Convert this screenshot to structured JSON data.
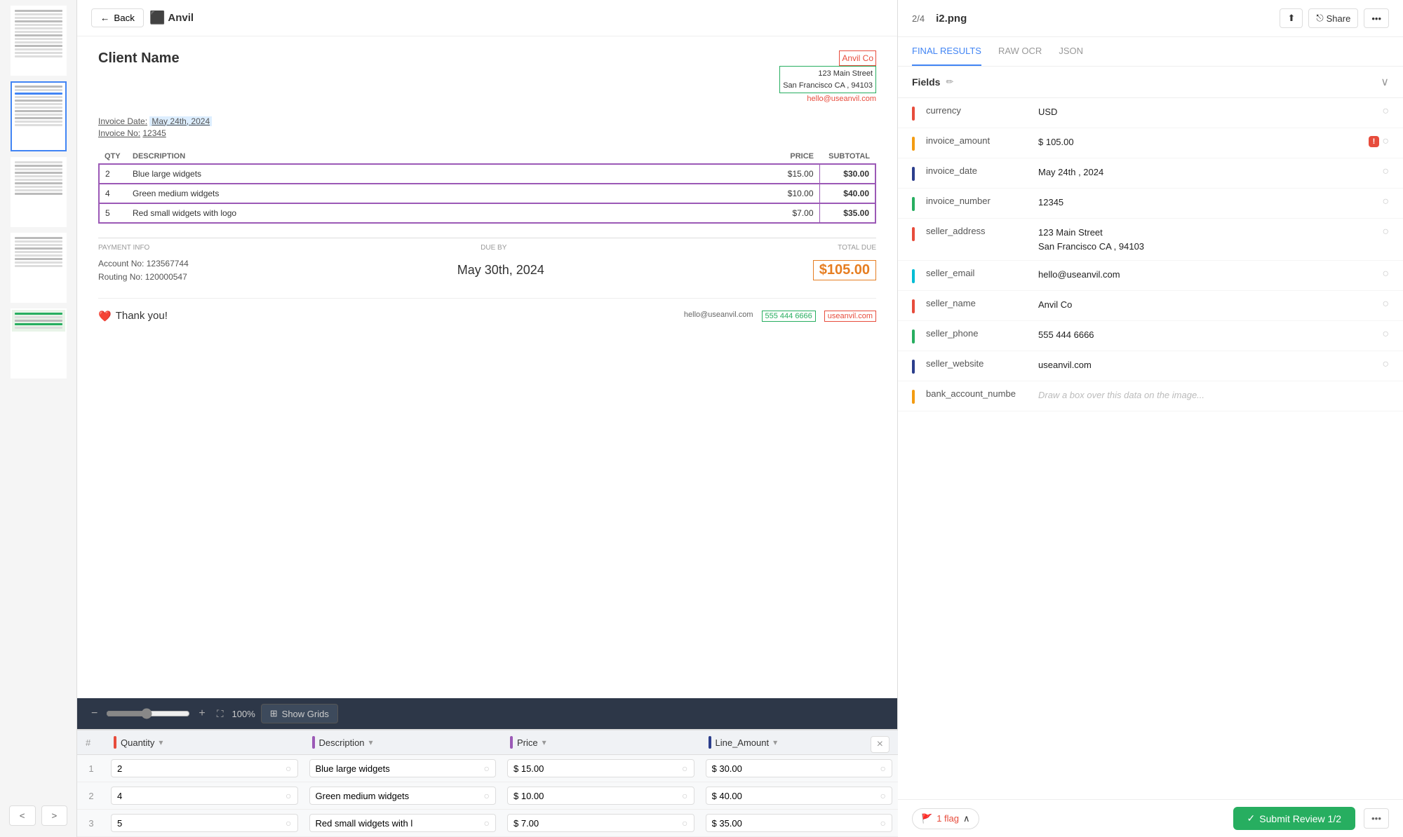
{
  "app": {
    "back_label": "Back"
  },
  "sidebar": {
    "thumbnails": [
      {
        "id": 1,
        "label": "Page 1 thumbnail"
      },
      {
        "id": 2,
        "label": "Page 2 thumbnail",
        "active": true
      },
      {
        "id": 3,
        "label": "Page 3 thumbnail"
      },
      {
        "id": 4,
        "label": "Page 4 thumbnail"
      },
      {
        "id": 5,
        "label": "Page 5 thumbnail"
      }
    ],
    "prev_label": "<",
    "next_label": ">"
  },
  "header": {
    "logo": "⬛ Anvil",
    "page_indicator": "2/4",
    "file_name": "i2.png",
    "upload_icon": "⬆",
    "share_label": "Share",
    "more_icon": "..."
  },
  "tabs": {
    "items": [
      {
        "id": "final",
        "label": "FINAL RESULTS",
        "active": true
      },
      {
        "id": "raw",
        "label": "RAW OCR",
        "active": false
      },
      {
        "id": "json",
        "label": "JSON",
        "active": false
      }
    ]
  },
  "invoice": {
    "client_name": "Client Name",
    "seller_name": "Anvil Co",
    "seller_address_line1": "123 Main Street",
    "seller_address_line2": "San Francisco CA , 94103",
    "seller_email": "hello@useanvil.com",
    "invoice_date_label": "Invoice Date:",
    "invoice_date_value": "May 24th, 2024",
    "invoice_no_label": "Invoice No:",
    "invoice_no_value": "12345",
    "table": {
      "headers": [
        "QTY",
        "DESCRIPTION",
        "PRICE",
        "SUBTOTAL"
      ],
      "rows": [
        {
          "qty": "2",
          "desc": "Blue large widgets",
          "price": "$15.00",
          "subtotal": "$30.00"
        },
        {
          "qty": "4",
          "desc": "Green medium widgets",
          "price": "$10.00",
          "subtotal": "$40.00"
        },
        {
          "qty": "5",
          "desc": "Red small widgets with logo",
          "price": "$7.00",
          "subtotal": "$35.00"
        }
      ]
    },
    "payment_info_label": "PAYMENT INFO",
    "due_by_label": "DUE BY",
    "total_due_label": "TOTAL DUE",
    "account_no_label": "Account No:",
    "account_no_value": "123567744",
    "routing_no_label": "Routing No:",
    "routing_no_value": "120000547",
    "due_date": "May 30th, 2024",
    "total_amount": "$105.00",
    "thank_you": "Thank you!",
    "contact_email": "hello@useanvil.com",
    "contact_phone": "555 444 6666",
    "contact_website": "useanvil.com"
  },
  "toolbar": {
    "zoom_minus": "−",
    "zoom_plus": "+",
    "zoom_level": "100%",
    "zoom_expand": "⛶",
    "show_grids_icon": "⊞",
    "show_grids_label": "Show Grids"
  },
  "fields": {
    "title": "Fields",
    "items": [
      {
        "id": "currency",
        "label": "currency",
        "value": "USD",
        "color": "#e74c3c",
        "has_warning": false
      },
      {
        "id": "invoice_amount",
        "label": "invoice_amount",
        "value": "$ 105.00",
        "color": "#f39c12",
        "has_warning": true,
        "warning_count": "!"
      },
      {
        "id": "invoice_date",
        "label": "invoice_date",
        "value": "May 24th , 2024",
        "color": "#2c3e8c",
        "has_warning": false
      },
      {
        "id": "invoice_number",
        "label": "invoice_number",
        "value": "12345",
        "color": "#27ae60",
        "has_warning": false
      },
      {
        "id": "seller_address",
        "label": "seller_address",
        "value": "123 Main Street\nSan Francisco CA , 94103",
        "color": "#e74c3c",
        "has_warning": false
      },
      {
        "id": "seller_email",
        "label": "seller_email",
        "value": "hello@useanvil.com",
        "color": "#00bcd4",
        "has_warning": false
      },
      {
        "id": "seller_name",
        "label": "seller_name",
        "value": "Anvil Co",
        "color": "#e74c3c",
        "has_warning": false
      },
      {
        "id": "seller_phone",
        "label": "seller_phone",
        "value": "555 444 6666",
        "color": "#27ae60",
        "has_warning": false
      },
      {
        "id": "seller_website",
        "label": "seller_website",
        "value": "useanvil.com",
        "color": "#2c3e8c",
        "has_warning": false
      },
      {
        "id": "bank_account_number",
        "label": "bank_account_numbe",
        "value": "Draw a box over this data on the image...",
        "color": "#f39c12",
        "has_warning": false,
        "faded": true
      }
    ]
  },
  "bottom_bar": {
    "flag_icon": "🚩",
    "flag_count": "1 flag",
    "chevron_up": "∧",
    "submit_label": "Submit Review 1/2",
    "check_icon": "✓",
    "more_icon": "..."
  },
  "data_table": {
    "close_icon": "×",
    "columns": [
      {
        "label": "Quantity",
        "color": "#e74c3c"
      },
      {
        "label": "Description",
        "color": "#9b59b6"
      },
      {
        "label": "Price",
        "color": "#9b59b6"
      },
      {
        "label": "Line_Amount",
        "color": "#2c3e8c"
      }
    ],
    "rows": [
      {
        "num": "1",
        "quantity": "2",
        "description": "Blue large widgets",
        "price": "$ 15.00",
        "line_amount": "$ 30.00"
      },
      {
        "num": "2",
        "quantity": "4",
        "description": "Green medium widgets",
        "price": "$ 10.00",
        "line_amount": "$ 40.00"
      },
      {
        "num": "3",
        "quantity": "5",
        "description": "Red small widgets with l",
        "price": "$ 7.00",
        "line_amount": "$ 35.00"
      }
    ]
  }
}
